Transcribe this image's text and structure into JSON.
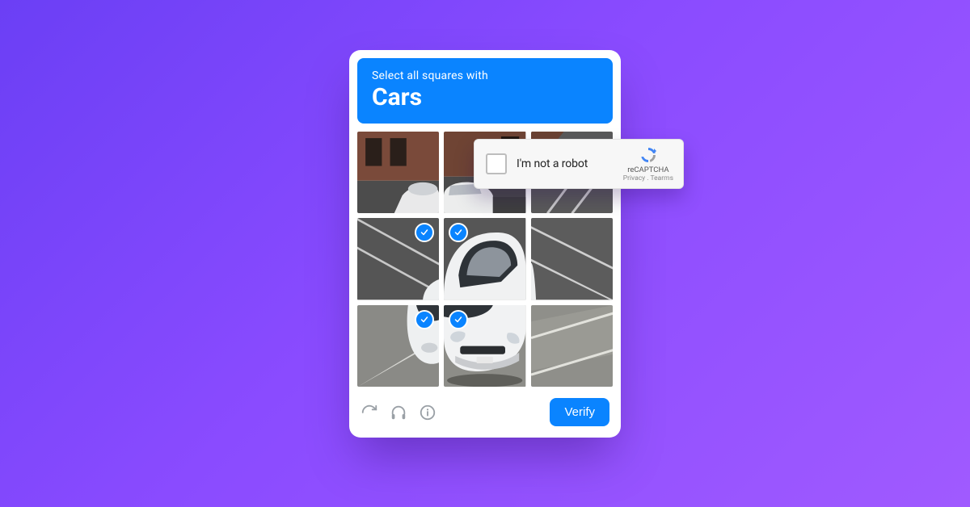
{
  "captcha": {
    "instruction": "Select all squares with",
    "target": "Cars",
    "verify_label": "Verify",
    "tiles": [
      {
        "selected": false
      },
      {
        "selected": false
      },
      {
        "selected": false
      },
      {
        "selected": true
      },
      {
        "selected": true
      },
      {
        "selected": false
      },
      {
        "selected": true
      },
      {
        "selected": true
      },
      {
        "selected": false
      }
    ],
    "icons": {
      "refresh": "refresh-icon",
      "audio": "headphones-icon",
      "info": "info-icon"
    }
  },
  "robot": {
    "label": "I'm not a robot",
    "brand": "reCAPTCHA",
    "legal": "Privacy . Tearms"
  }
}
